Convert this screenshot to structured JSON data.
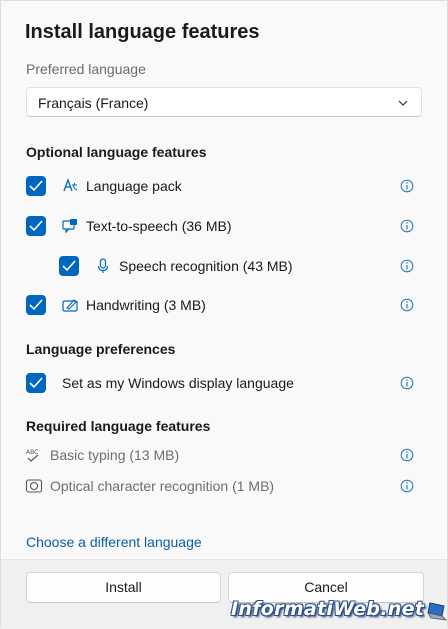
{
  "dialog": {
    "title": "Install language features",
    "preferred_label": "Preferred language",
    "preferred_value": "Français (France)"
  },
  "optional": {
    "heading": "Optional language features",
    "items": [
      {
        "label": "Language pack",
        "checked": true,
        "icon": "language-pack-icon"
      },
      {
        "label": "Text-to-speech (36 MB)",
        "checked": true,
        "icon": "text-to-speech-icon"
      },
      {
        "label": "Speech recognition (43 MB)",
        "checked": true,
        "icon": "microphone-icon"
      },
      {
        "label": "Handwriting (3 MB)",
        "checked": true,
        "icon": "handwriting-icon"
      }
    ]
  },
  "preferences": {
    "heading": "Language preferences",
    "display_language": "Set as my Windows display language"
  },
  "required": {
    "heading": "Required language features",
    "items": [
      {
        "label": "Basic typing (13 MB)",
        "icon": "basic-typing-icon"
      },
      {
        "label": "Optical character recognition (1 MB)",
        "icon": "ocr-icon"
      }
    ]
  },
  "links": {
    "choose_different": "Choose a different language"
  },
  "buttons": {
    "install": "Install",
    "cancel": "Cancel"
  },
  "watermark": {
    "text": "InformatiWeb.net"
  },
  "colors": {
    "accent": "#0067c0",
    "link": "#0a5fa8",
    "info": "#1f6fb5"
  }
}
